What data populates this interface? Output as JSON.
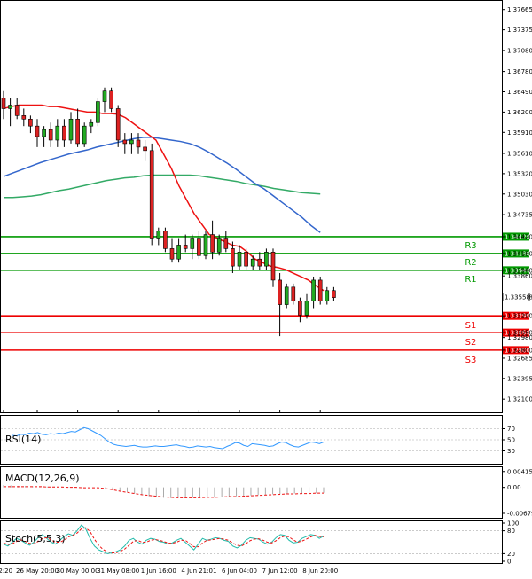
{
  "chart_data": {
    "type": "candlestick",
    "y_range": [
      1.3195,
      1.3775
    ],
    "y_ticks": [
      "1.37665",
      "1.37375",
      "1.37080",
      "1.36780",
      "1.36490",
      "1.36200",
      "1.35910",
      "1.35610",
      "1.35320",
      "1.35030",
      "1.34735",
      "1.34420",
      "1.34180",
      "1.33940",
      "1.33860",
      "1.33558",
      "1.33290",
      "1.33050",
      "1.32980",
      "1.32800",
      "1.32685",
      "1.32395",
      "1.32100"
    ],
    "x_labels": [
      {
        "label": "12:20",
        "i": 0
      },
      {
        "label": "26 May 20:00",
        "i": 5
      },
      {
        "label": "30 May 00:00",
        "i": 11
      },
      {
        "label": "31 May 08:00",
        "i": 17
      },
      {
        "label": "1 Jun 16:00",
        "i": 23
      },
      {
        "label": "4 Jun 21:01",
        "i": 29
      },
      {
        "label": "6 Jun 04:00",
        "i": 35
      },
      {
        "label": "7 Jun 12:00",
        "i": 41
      },
      {
        "label": "8 Jun 20:00",
        "i": 47
      }
    ],
    "candles": [
      [
        1.364,
        1.365,
        1.361,
        1.3625
      ],
      [
        1.3625,
        1.364,
        1.36,
        1.363
      ],
      [
        1.363,
        1.364,
        1.361,
        1.3615
      ],
      [
        1.3615,
        1.3625,
        1.36,
        1.361
      ],
      [
        1.361,
        1.3615,
        1.359,
        1.36
      ],
      [
        1.36,
        1.361,
        1.357,
        1.3585
      ],
      [
        1.3585,
        1.36,
        1.357,
        1.3595
      ],
      [
        1.3595,
        1.3605,
        1.357,
        1.358
      ],
      [
        1.358,
        1.361,
        1.357,
        1.36
      ],
      [
        1.36,
        1.361,
        1.357,
        1.358
      ],
      [
        1.358,
        1.362,
        1.3575,
        1.361
      ],
      [
        1.361,
        1.3625,
        1.357,
        1.3575
      ],
      [
        1.3575,
        1.3605,
        1.357,
        1.36
      ],
      [
        1.36,
        1.361,
        1.359,
        1.3605
      ],
      [
        1.3605,
        1.364,
        1.36,
        1.3635
      ],
      [
        1.3635,
        1.3655,
        1.362,
        1.365
      ],
      [
        1.365,
        1.3655,
        1.362,
        1.3625
      ],
      [
        1.3625,
        1.363,
        1.357,
        1.358
      ],
      [
        1.358,
        1.359,
        1.356,
        1.3575
      ],
      [
        1.3575,
        1.359,
        1.356,
        1.358
      ],
      [
        1.358,
        1.359,
        1.356,
        1.357
      ],
      [
        1.357,
        1.358,
        1.355,
        1.3565
      ],
      [
        1.3565,
        1.3575,
        1.343,
        1.344
      ],
      [
        1.344,
        1.3455,
        1.343,
        1.345
      ],
      [
        1.345,
        1.3455,
        1.342,
        1.3425
      ],
      [
        1.3425,
        1.344,
        1.3405,
        1.341
      ],
      [
        1.341,
        1.344,
        1.3405,
        1.343
      ],
      [
        1.343,
        1.3445,
        1.342,
        1.3425
      ],
      [
        1.3425,
        1.3445,
        1.341,
        1.344
      ],
      [
        1.344,
        1.345,
        1.341,
        1.3415
      ],
      [
        1.3415,
        1.345,
        1.341,
        1.3445
      ],
      [
        1.3445,
        1.3465,
        1.341,
        1.342
      ],
      [
        1.342,
        1.3445,
        1.3415,
        1.344
      ],
      [
        1.344,
        1.345,
        1.342,
        1.3425
      ],
      [
        1.3425,
        1.3435,
        1.339,
        1.34
      ],
      [
        1.34,
        1.343,
        1.3395,
        1.342
      ],
      [
        1.342,
        1.3425,
        1.3395,
        1.34
      ],
      [
        1.34,
        1.3415,
        1.3395,
        1.341
      ],
      [
        1.341,
        1.342,
        1.3395,
        1.34
      ],
      [
        1.34,
        1.3425,
        1.3395,
        1.342
      ],
      [
        1.342,
        1.3425,
        1.337,
        1.338
      ],
      [
        1.338,
        1.339,
        1.33,
        1.3345
      ],
      [
        1.3345,
        1.3375,
        1.334,
        1.337
      ],
      [
        1.337,
        1.3375,
        1.3345,
        1.335
      ],
      [
        1.335,
        1.3355,
        1.332,
        1.333
      ],
      [
        1.333,
        1.336,
        1.3325,
        1.335
      ],
      [
        1.335,
        1.3385,
        1.334,
        1.338
      ],
      [
        1.338,
        1.3385,
        1.3345,
        1.335
      ],
      [
        1.335,
        1.337,
        1.3345,
        1.3365
      ],
      [
        1.3365,
        1.337,
        1.335,
        1.3355
      ]
    ],
    "ma_red": [
      1.3625,
      1.3628,
      1.363,
      1.363,
      1.363,
      1.363,
      1.3628,
      1.3628,
      1.3626,
      1.3624,
      1.3622,
      1.362,
      1.362,
      1.3618,
      1.3618,
      1.3617,
      1.3612,
      1.3604,
      1.3596,
      1.3588,
      1.358,
      1.356,
      1.354,
      1.3515,
      1.3495,
      1.3475,
      1.346,
      1.3445,
      1.344,
      1.3435,
      1.343,
      1.3428,
      1.342,
      1.341,
      1.3405,
      1.34,
      1.3398,
      1.3395,
      1.339,
      1.3385,
      1.338,
      1.3372,
      1.3365
    ],
    "ma_blue": [
      1.3528,
      1.3533,
      1.3538,
      1.3543,
      1.3548,
      1.3552,
      1.3556,
      1.356,
      1.3563,
      1.3566,
      1.357,
      1.3573,
      1.3576,
      1.3579,
      1.3582,
      1.3584,
      1.3584,
      1.3582,
      1.358,
      1.3578,
      1.3575,
      1.357,
      1.3563,
      1.3555,
      1.3547,
      1.3538,
      1.3528,
      1.3518,
      1.351,
      1.35,
      1.349,
      1.348,
      1.347,
      1.3458,
      1.3448
    ],
    "ma_green": [
      1.3498,
      1.3498,
      1.3499,
      1.35,
      1.3502,
      1.3505,
      1.3508,
      1.351,
      1.3513,
      1.3516,
      1.3519,
      1.3522,
      1.3524,
      1.3526,
      1.3527,
      1.3529,
      1.353,
      1.353,
      1.353,
      1.353,
      1.353,
      1.3529,
      1.3527,
      1.3525,
      1.3523,
      1.3521,
      1.3518,
      1.3516,
      1.3514,
      1.3511,
      1.3509,
      1.3507,
      1.3505,
      1.3504,
      1.3503
    ],
    "levels": [
      {
        "name": "R3",
        "value": 1.3442,
        "label": "1.34420",
        "color": "#009900"
      },
      {
        "name": "R2",
        "value": 1.3418,
        "label": "1.34180",
        "color": "#009900"
      },
      {
        "name": "R1",
        "value": 1.3394,
        "label": "1.33940",
        "color": "#009900"
      },
      {
        "name": "S1",
        "value": 1.3329,
        "label": "1.33290",
        "color": "#ee0000"
      },
      {
        "name": "S2",
        "value": 1.3305,
        "label": "1.33050",
        "color": "#ee0000"
      },
      {
        "name": "S3",
        "value": 1.328,
        "label": "1.32800",
        "color": "#ee0000"
      }
    ],
    "current_price": "1.33558",
    "rsi": {
      "title": "RSI(14)",
      "ticks": [
        "70",
        "50",
        "30"
      ],
      "range": [
        10,
        90
      ],
      "values": [
        58,
        57,
        60,
        59,
        62,
        61,
        63,
        60,
        59,
        61,
        60,
        62,
        61,
        63,
        65,
        64,
        68,
        72,
        70,
        66,
        62,
        58,
        52,
        46,
        42,
        40,
        39,
        38,
        39,
        40,
        38,
        37,
        37,
        38,
        39,
        38,
        38,
        39,
        40,
        41,
        39,
        38,
        36,
        37,
        39,
        38,
        37,
        38,
        36,
        35,
        34,
        38,
        41,
        45,
        44,
        40,
        38,
        43,
        42,
        41,
        40,
        38,
        39,
        43,
        46,
        45,
        41,
        38,
        37,
        40,
        43,
        46,
        45,
        43,
        46
      ]
    },
    "macd": {
      "title": "MACD(12,26,9)",
      "ticks": [
        "0.004158",
        "0.00",
        "-0.006798"
      ],
      "range": [
        -0.0075,
        0.0048
      ],
      "hist": [
        0.0006,
        0.0005,
        0.0004,
        0.0004,
        0.0003,
        0.0003,
        0.0002,
        0.0002,
        0.0001,
        0.0001,
        0.0001,
        0.0,
        0.0,
        0.0,
        -0.0003,
        -0.0006,
        -0.0009,
        -0.0012,
        -0.0016,
        -0.002,
        -0.0023,
        -0.0026,
        -0.0027,
        -0.0028,
        -0.0028,
        -0.0028,
        -0.0027,
        -0.0026,
        -0.0026,
        -0.0025,
        -0.0025,
        -0.0024,
        -0.0023,
        -0.0022,
        -0.0021,
        -0.002,
        -0.0019,
        -0.0018,
        -0.0017,
        -0.0016,
        -0.0016,
        -0.0016,
        -0.0015,
        -0.0015,
        -0.0014
      ],
      "signal": [
        0.0002,
        0.0002,
        0.0002,
        0.0002,
        0.0002,
        0.0002,
        0.0001,
        0.0001,
        0.0001,
        0.0,
        0.0,
        -0.0001,
        -0.0001,
        -0.0001,
        -0.0003,
        -0.0006,
        -0.001,
        -0.0013,
        -0.0016,
        -0.0019,
        -0.0021,
        -0.0023,
        -0.0025,
        -0.0026,
        -0.0027,
        -0.0027,
        -0.0027,
        -0.0027,
        -0.0026,
        -0.0026,
        -0.0025,
        -0.0024,
        -0.0024,
        -0.0023,
        -0.0022,
        -0.0021,
        -0.002,
        -0.0019,
        -0.0018,
        -0.0017,
        -0.0017,
        -0.0016,
        -0.0016,
        -0.0015,
        -0.0015
      ]
    },
    "stoch": {
      "title": "Stoch(5,5,3)",
      "ticks": [
        "100",
        "80",
        "20",
        "0"
      ],
      "range": [
        0,
        100
      ],
      "k": [
        45,
        40,
        50,
        60,
        55,
        48,
        42,
        50,
        62,
        70,
        60,
        50,
        45,
        55,
        65,
        72,
        68,
        80,
        95,
        85,
        60,
        40,
        30,
        25,
        20,
        22,
        25,
        30,
        40,
        55,
        60,
        50,
        45,
        55,
        60,
        58,
        52,
        50,
        45,
        48,
        55,
        60,
        50,
        40,
        30,
        45,
        60,
        55,
        58,
        62,
        60,
        55,
        52,
        40,
        35,
        42,
        55,
        62,
        60,
        58,
        50,
        45,
        50,
        62,
        70,
        68,
        55,
        48,
        50,
        60,
        65,
        70,
        68,
        60,
        66
      ],
      "d": [
        48,
        44,
        46,
        52,
        56,
        52,
        47,
        46,
        52,
        60,
        62,
        56,
        50,
        50,
        55,
        64,
        68,
        74,
        85,
        88,
        78,
        58,
        42,
        31,
        25,
        22,
        22,
        26,
        32,
        42,
        52,
        55,
        50,
        50,
        55,
        57,
        55,
        52,
        48,
        47,
        50,
        55,
        55,
        47,
        38,
        38,
        48,
        55,
        56,
        58,
        60,
        58,
        55,
        48,
        42,
        40,
        46,
        54,
        58,
        59,
        55,
        50,
        48,
        54,
        62,
        66,
        64,
        56,
        50,
        53,
        58,
        64,
        68,
        65,
        64
      ]
    }
  }
}
